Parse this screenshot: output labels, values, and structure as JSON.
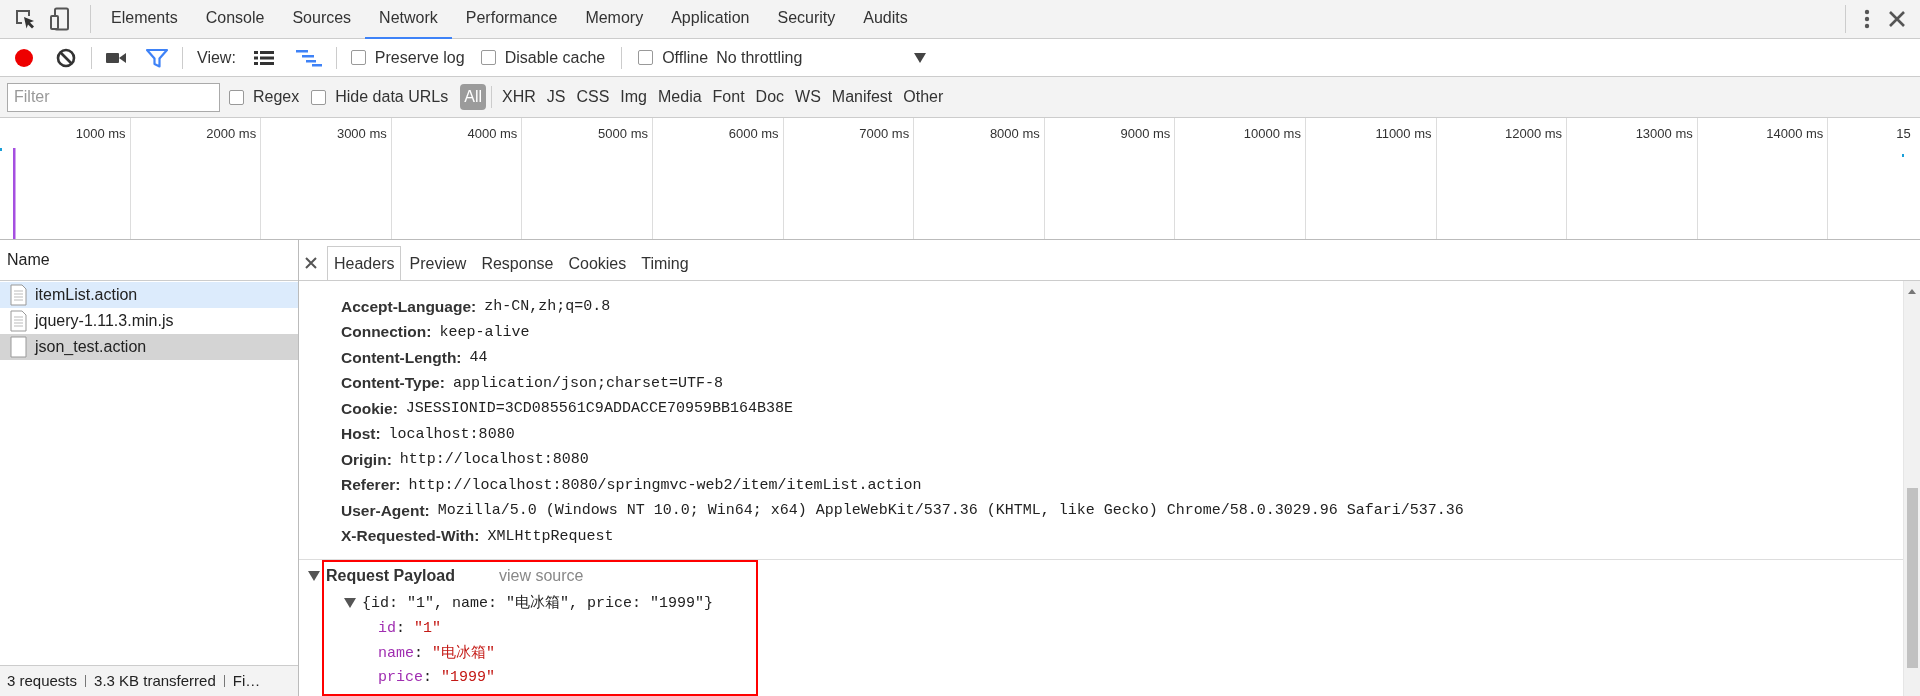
{
  "tabs": [
    {
      "label": "Elements",
      "selected": false
    },
    {
      "label": "Console",
      "selected": false
    },
    {
      "label": "Sources",
      "selected": false
    },
    {
      "label": "Network",
      "selected": true
    },
    {
      "label": "Performance",
      "selected": false
    },
    {
      "label": "Memory",
      "selected": false
    },
    {
      "label": "Application",
      "selected": false
    },
    {
      "label": "Security",
      "selected": false
    },
    {
      "label": "Audits",
      "selected": false
    }
  ],
  "toolbar": {
    "recording": true,
    "filter_active": true,
    "view_label": "View:",
    "large_rows": false,
    "overview": true,
    "options": [
      {
        "label": "Preserve log",
        "checked": false
      },
      {
        "label": "Disable cache",
        "checked": false
      },
      {
        "label": "Offline",
        "checked": false
      }
    ],
    "throttling": "No throttling"
  },
  "filter_bar": {
    "placeholder": "Filter",
    "options": [
      {
        "label": "Regex",
        "checked": false
      },
      {
        "label": "Hide data URLs",
        "checked": false
      }
    ],
    "types": [
      {
        "label": "All",
        "selected": true
      },
      {
        "label": "XHR",
        "selected": false
      },
      {
        "label": "JS",
        "selected": false
      },
      {
        "label": "CSS",
        "selected": false
      },
      {
        "label": "Img",
        "selected": false
      },
      {
        "label": "Media",
        "selected": false
      },
      {
        "label": "Font",
        "selected": false
      },
      {
        "label": "Doc",
        "selected": false
      },
      {
        "label": "WS",
        "selected": false
      },
      {
        "label": "Manifest",
        "selected": false
      },
      {
        "label": "Other",
        "selected": false
      }
    ]
  },
  "timeline": {
    "ticks": [
      "1000 ms",
      "2000 ms",
      "3000 ms",
      "4000 ms",
      "5000 ms",
      "6000 ms",
      "7000 ms",
      "8000 ms",
      "9000 ms",
      "10000 ms",
      "11000 ms",
      "12000 ms",
      "13000 ms",
      "14000 ms",
      "15"
    ]
  },
  "requests": {
    "column": "Name",
    "items": [
      {
        "name": "itemList.action",
        "hovered": true,
        "selected": false,
        "kind": "script"
      },
      {
        "name": "jquery-1.11.3.min.js",
        "hovered": false,
        "selected": false,
        "kind": "script"
      },
      {
        "name": "json_test.action",
        "hovered": false,
        "selected": true,
        "kind": "blank"
      }
    ]
  },
  "status_bar": [
    "3 requests",
    "3.3 KB transferred",
    "Fi…"
  ],
  "detail": {
    "tabs": [
      {
        "label": "Headers",
        "selected": true
      },
      {
        "label": "Preview",
        "selected": false
      },
      {
        "label": "Response",
        "selected": false
      },
      {
        "label": "Cookies",
        "selected": false
      },
      {
        "label": "Timing",
        "selected": false
      }
    ],
    "headers": [
      {
        "name": "Accept-Language:",
        "value": "zh-CN,zh;q=0.8"
      },
      {
        "name": "Connection:",
        "value": "keep-alive"
      },
      {
        "name": "Content-Length:",
        "value": "44"
      },
      {
        "name": "Content-Type:",
        "value": "application/json;charset=UTF-8"
      },
      {
        "name": "Cookie:",
        "value": "JSESSIONID=3CD085561C9ADDACCE70959BB164B38E"
      },
      {
        "name": "Host:",
        "value": "localhost:8080"
      },
      {
        "name": "Origin:",
        "value": "http://localhost:8080"
      },
      {
        "name": "Referer:",
        "value": "http://localhost:8080/springmvc-web2/item/itemList.action"
      },
      {
        "name": "User-Agent:",
        "value": "Mozilla/5.0 (Windows NT 10.0; Win64; x64) AppleWebKit/537.36 (KHTML, like Gecko) Chrome/58.0.3029.96 Safari/537.36"
      },
      {
        "name": "X-Requested-With:",
        "value": "XMLHttpRequest"
      }
    ],
    "payload": {
      "title": "Request Payload",
      "expanded": true,
      "highlighted": true,
      "view_source": "view source",
      "object": {
        "summary": "{id: \"1\", name: \"电冰箱\", price: \"1999\"}",
        "expanded": true,
        "properties": [
          {
            "key": "id",
            "separator": ":",
            "value": "\"1\""
          },
          {
            "key": "name",
            "separator": ":",
            "value": "\"电冰箱\""
          },
          {
            "key": "price",
            "separator": ":",
            "value": "\"1999\""
          }
        ]
      }
    }
  }
}
